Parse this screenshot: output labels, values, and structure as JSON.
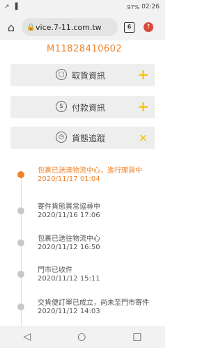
{
  "status_bar": {
    "left": "↗ ▐",
    "battery": "97%",
    "time": "02:26"
  },
  "browser": {
    "url": "vice.7-11.com.tw",
    "tab_count": "6"
  },
  "order": {
    "number": "M11828410602"
  },
  "panels": [
    {
      "label": "取貨資訊",
      "action": "+",
      "icon": "box-icon"
    },
    {
      "label": "付款資訊",
      "action": "+",
      "icon": "coin-icon"
    },
    {
      "label": "貨態追蹤",
      "action": "✕",
      "icon": "clock-icon"
    }
  ],
  "timeline": [
    {
      "text": "包裹已送達物流中心，進行理貨中",
      "date": "2020/11/17 01:04",
      "active": true
    },
    {
      "text": "寄件貨態異常協尋中",
      "date": "2020/11/16 17:06",
      "active": false
    },
    {
      "text": "包裹已送往物流中心",
      "date": "2020/11/12 16:50",
      "active": false
    },
    {
      "text": "門市已收件",
      "date": "2020/11/12 15:11",
      "active": false
    },
    {
      "text": "交貨便訂單已成立，尚未至門市寄件",
      "date": "2020/11/12 14:03",
      "active": false
    }
  ],
  "nav": {
    "back": "◁",
    "home": "○",
    "recents": "□"
  }
}
